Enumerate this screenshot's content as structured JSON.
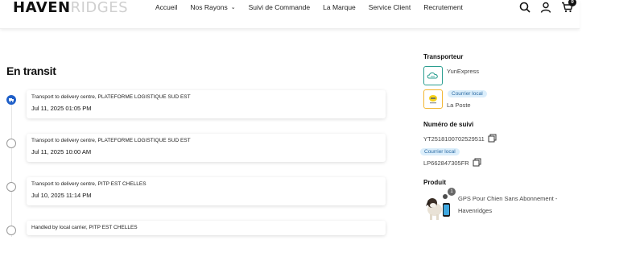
{
  "header": {
    "logo_bold": "HAVEN",
    "logo_light": "RIDGES",
    "nav": [
      {
        "label": "Accueil"
      },
      {
        "label": "Nos Rayons",
        "has_dropdown": true
      },
      {
        "label": "Suivi de Commande"
      },
      {
        "label": "La Marque"
      },
      {
        "label": "Service Client"
      },
      {
        "label": "Recrutement"
      }
    ],
    "icons": [
      "search-icon",
      "account-icon",
      "cart-icon"
    ],
    "cart_count": "0"
  },
  "status": {
    "title": "En transit"
  },
  "timeline": [
    {
      "event": "Transport to delivery centre, PLATEFORME LOGISTIQUE SUD EST",
      "datetime": "Jul 11, 2025 01:05 PM",
      "active": true
    },
    {
      "event": "Transport to delivery centre, PLATEFORME LOGISTIQUE SUD EST",
      "datetime": "Jul 11, 2025 10:00 AM",
      "active": false
    },
    {
      "event": "Transport to delivery centre, PITP EST CHELLES",
      "datetime": "Jul 10, 2025 11:14 PM",
      "active": false
    },
    {
      "event": "Handled by local carrier, PITP EST CHELLES",
      "datetime": "",
      "active": false
    }
  ],
  "sidebar": {
    "carrier_label": "Transporteur",
    "carriers": [
      {
        "name": "YunExpress",
        "icon": "yunexpress-logo",
        "border": "#2a9d8f"
      },
      {
        "name": "La Poste",
        "icon": "laposte-logo",
        "border": "#f2b632",
        "chip": "Courrier local"
      }
    ],
    "tracking_label": "Numéro de suivi",
    "tracking_numbers": [
      {
        "number": "YT2518100702529511"
      },
      {
        "number": "LP662847305FR",
        "chip": "Courrier local"
      }
    ],
    "product_label": "Produit",
    "product": {
      "title": "GPS Pour Chien Sans Abonnement - Havenridges",
      "quantity": "1"
    }
  }
}
